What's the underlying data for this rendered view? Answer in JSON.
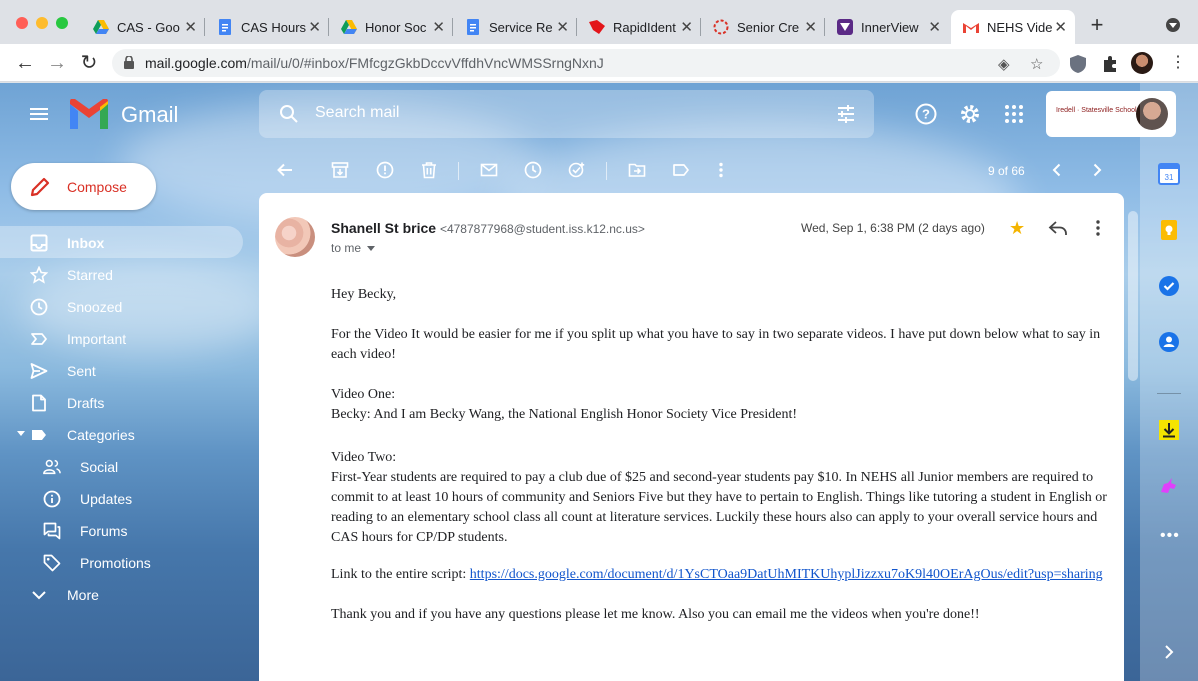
{
  "browser": {
    "tabs": [
      {
        "title": "CAS - Goo",
        "icon": "google-drive-icon"
      },
      {
        "title": "CAS Hours",
        "icon": "google-docs-icon"
      },
      {
        "title": "Honor Soc",
        "icon": "google-drive-icon"
      },
      {
        "title": "Service Re",
        "icon": "google-docs-icon"
      },
      {
        "title": "RapidIdent",
        "icon": "rapididentity-icon"
      },
      {
        "title": "Senior Cre",
        "icon": "loading-icon"
      },
      {
        "title": "InnerView",
        "icon": "innerview-icon"
      },
      {
        "title": "NEHS Vide",
        "icon": "gmail-icon"
      }
    ],
    "url_host": "mail.google.com",
    "url_path": "/mail/u/0/#inbox/FMfcgzGkbDccvVffdhVncWMSSrngNxnJ"
  },
  "gmail": {
    "brand": "Gmail",
    "search_placeholder": "Search mail",
    "org_label": "Iredell · Statesville Schools",
    "compose_label": "Compose",
    "nav": [
      {
        "label": "Inbox",
        "icon": "inbox-icon",
        "active": true
      },
      {
        "label": "Starred",
        "icon": "star-icon"
      },
      {
        "label": "Snoozed",
        "icon": "clock-icon"
      },
      {
        "label": "Important",
        "icon": "important-icon"
      },
      {
        "label": "Sent",
        "icon": "send-icon"
      },
      {
        "label": "Drafts",
        "icon": "draft-icon"
      },
      {
        "label": "Categories",
        "icon": "label-icon"
      },
      {
        "label": "Social",
        "icon": "people-icon"
      },
      {
        "label": "Updates",
        "icon": "info-icon"
      },
      {
        "label": "Forums",
        "icon": "forum-icon"
      },
      {
        "label": "Promotions",
        "icon": "tag-icon"
      },
      {
        "label": "More",
        "icon": "chevron-down-icon"
      }
    ],
    "pager": "9 of 66"
  },
  "message": {
    "sender_name": "Shanell St brice",
    "sender_email": "<4787877968@student.iss.k12.nc.us>",
    "to": "to me",
    "date": "Wed, Sep 1, 6:38 PM (2 days ago)",
    "starred": true,
    "greeting": "Hey Becky,",
    "para1": "For the Video It would be easier for me if you split up what you have to say in two separate videos. I have put down below what to say in each video!",
    "video1_heading": "Video One:",
    "video1_text": "Becky: And I am Becky Wang, the National English Honor Society Vice President!",
    "video2_heading": "Video Two:",
    "video2_text": "First-Year students are required to pay a club due of $25 and second-year students pay $10. In NEHS all Junior members are required to commit to at least 10 hours of community and Seniors Five but they have to pertain to English. Things like tutoring a student in English or reading to an elementary school class all count at literature services. Luckily these hours also can apply to your overall service hours and CAS hours for CP/DP students.",
    "link_prefix": "Link to the entire script: ",
    "link_url": "https://docs.google.com/document/d/1YsCTOaa9DatUhMITKUhyplJizzxu7oK9l40OErAgOus/edit?usp=sharing",
    "closing": "Thank you and if you have any questions please let me know. Also you can email me the videos when you're done!!"
  }
}
